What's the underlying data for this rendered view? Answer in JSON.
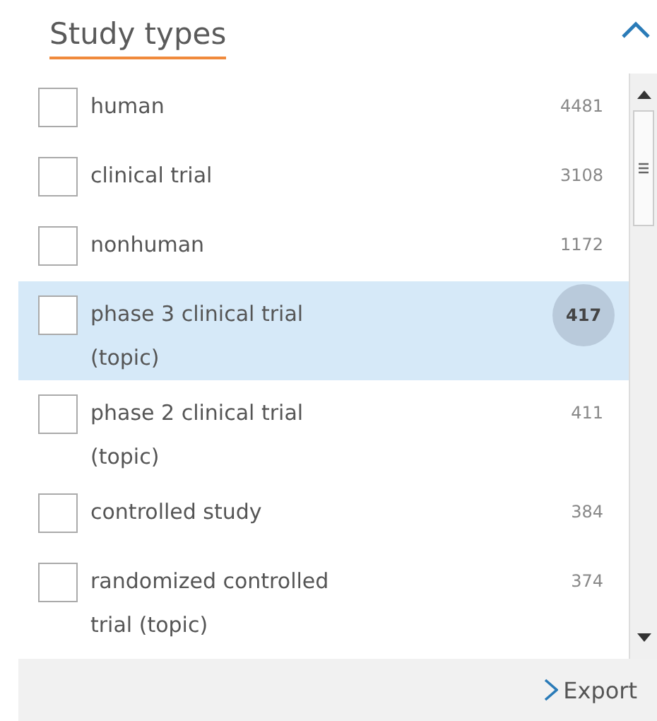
{
  "panel": {
    "title": "Study types",
    "expanded": true
  },
  "items": [
    {
      "label": "human",
      "count": "4481",
      "checked": false,
      "selected": false
    },
    {
      "label": "clinical trial",
      "count": "3108",
      "checked": false,
      "selected": false
    },
    {
      "label": "nonhuman",
      "count": "1172",
      "checked": false,
      "selected": false
    },
    {
      "label": "phase 3 clinical trial (topic)",
      "count": "417",
      "checked": false,
      "selected": true
    },
    {
      "label": "phase 2 clinical trial (topic)",
      "count": "411",
      "checked": false,
      "selected": false
    },
    {
      "label": "controlled study",
      "count": "384",
      "checked": false,
      "selected": false
    },
    {
      "label": "randomized controlled trial (topic)",
      "count": "374",
      "checked": false,
      "selected": false
    }
  ],
  "footer": {
    "export_label": "Export"
  }
}
